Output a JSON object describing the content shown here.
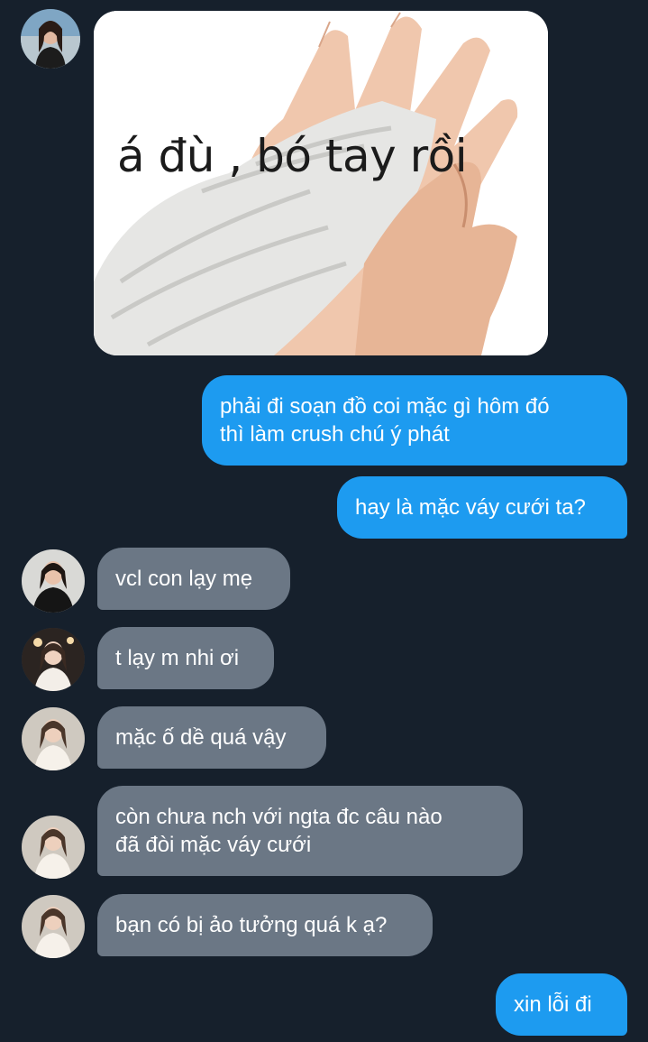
{
  "sticker": {
    "caption": "á đù , bó tay rồi"
  },
  "messages": [
    {
      "dir": "out",
      "lines": [
        "phải đi soạn đồ coi mặc gì hôm đó",
        "thì làm crush chú ý phát"
      ]
    },
    {
      "dir": "out",
      "lines": [
        "hay là mặc váy cưới ta?"
      ]
    },
    {
      "dir": "in",
      "lines": [
        "vcl con lạy mẹ"
      ]
    },
    {
      "dir": "in",
      "lines": [
        "t lạy m nhi ơi"
      ]
    },
    {
      "dir": "in",
      "lines": [
        "mặc ố dề quá vậy"
      ]
    },
    {
      "dir": "in",
      "lines": [
        "còn chưa nch với ngta đc câu nào",
        "đã đòi mặc váy cưới"
      ]
    },
    {
      "dir": "in",
      "lines": [
        "bạn có bị ảo tưởng quá k ạ?"
      ]
    },
    {
      "dir": "out",
      "lines": [
        "xin lỗi đi"
      ]
    }
  ],
  "colors": {
    "background": "#16202c",
    "outgoing_bubble": "#1d9bf0",
    "incoming_bubble": "#6b7785",
    "text": "#ffffff"
  },
  "icons": {
    "avatar": "profile-photo"
  }
}
